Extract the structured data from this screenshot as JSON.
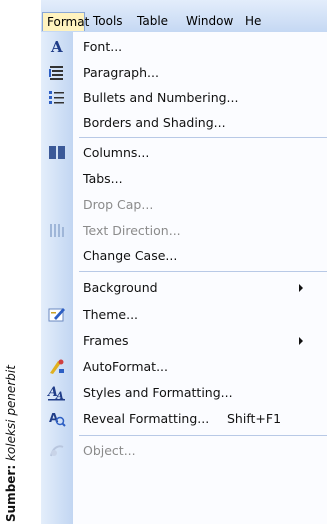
{
  "caption": {
    "label": "Sumber:",
    "text": "koleksi penerbit"
  },
  "menubar": [
    "Format",
    "Tools",
    "Table",
    "Window",
    "He"
  ],
  "menu": {
    "items": [
      {
        "label": "Font...",
        "icon": "font-a-icon"
      },
      {
        "label": "Paragraph...",
        "icon": "paragraph-icon"
      },
      {
        "label": "Bullets and Numbering...",
        "icon": "bullets-icon"
      },
      {
        "label": "Borders and Shading...",
        "icon": ""
      },
      {
        "label": "Columns...",
        "icon": "columns-icon"
      },
      {
        "label": "Tabs...",
        "icon": ""
      },
      {
        "label": "Drop Cap...",
        "icon": "",
        "disabled": true
      },
      {
        "label": "Text Direction...",
        "icon": "text-direction-icon",
        "disabled": true
      },
      {
        "label": "Change Case...",
        "icon": ""
      },
      {
        "label": "Background",
        "icon": "",
        "submenu": true
      },
      {
        "label": "Theme...",
        "icon": "theme-icon"
      },
      {
        "label": "Frames",
        "icon": "",
        "submenu": true
      },
      {
        "label": "AutoFormat...",
        "icon": "autoformat-icon"
      },
      {
        "label": "Styles and Formatting...",
        "icon": "styles-icon"
      },
      {
        "label": "Reveal Formatting...",
        "icon": "reveal-formatting-icon",
        "shortcut": "Shift+F1"
      },
      {
        "label": "Object...",
        "icon": "object-icon",
        "disabled": true
      }
    ]
  }
}
